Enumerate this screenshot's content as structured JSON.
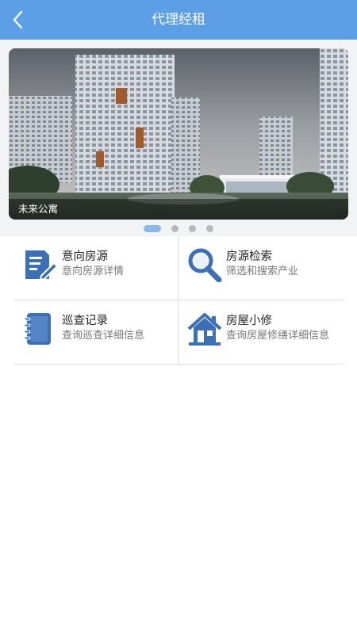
{
  "header": {
    "title": "代理经租",
    "back_icon": "chevron-left-icon",
    "color": "#5c9fe6"
  },
  "banner": {
    "caption": "未来公寓",
    "slide_count": 4,
    "active_index": 0
  },
  "menu": [
    {
      "title": "意向房源",
      "desc": "意向房源详情",
      "icon": "document-edit-icon"
    },
    {
      "title": "房源检索",
      "desc": "筛选和搜索产业",
      "icon": "magnifier-icon"
    },
    {
      "title": "巡查记录",
      "desc": "查询巡查详细信息",
      "icon": "notebook-icon"
    },
    {
      "title": "房屋小修",
      "desc": "查询房屋修缮详细信息",
      "icon": "house-icon"
    }
  ],
  "colors": {
    "icon": "#3b6fb6",
    "divider": "#dddddd"
  }
}
